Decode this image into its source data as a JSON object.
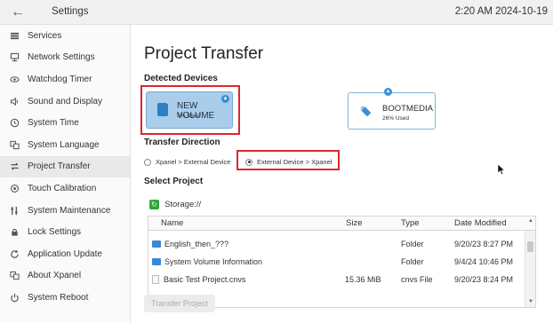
{
  "topbar": {
    "back_icon": "arrow-left-icon",
    "title": "Settings",
    "datetime": "2:20 AM 2024-10-19"
  },
  "sidebar": {
    "items": [
      {
        "label": "Services",
        "icon": "services-icon"
      },
      {
        "label": "Network Settings",
        "icon": "network-icon"
      },
      {
        "label": "Watchdog Timer",
        "icon": "eye-icon"
      },
      {
        "label": "Sound and Display",
        "icon": "speaker-icon"
      },
      {
        "label": "System Time",
        "icon": "clock-icon"
      },
      {
        "label": "System Language",
        "icon": "language-icon"
      },
      {
        "label": "Project Transfer",
        "icon": "transfer-icon",
        "active": true
      },
      {
        "label": "Touch Calibration",
        "icon": "target-icon"
      },
      {
        "label": "System Maintenance",
        "icon": "maintenance-icon"
      },
      {
        "label": "Lock Settings",
        "icon": "lock-icon"
      },
      {
        "label": "Application Update",
        "icon": "refresh-icon"
      },
      {
        "label": "About Xpanel",
        "icon": "info-icon"
      },
      {
        "label": "System Reboot",
        "icon": "power-icon"
      }
    ]
  },
  "main": {
    "title": "Project Transfer",
    "detected_devices_label": "Detected Devices",
    "devices": [
      {
        "name": "NEW VOLUME",
        "usage": "5% Used",
        "selected": true,
        "icon": "sd-card-icon"
      },
      {
        "name": "BOOTMEDIA",
        "usage": "26% Used",
        "selected": false,
        "icon": "usb-drive-icon"
      }
    ],
    "transfer_direction_label": "Transfer Direction",
    "directions": [
      {
        "label": "Xpanel > External Device",
        "selected": false
      },
      {
        "label": "External Device > Xpanel",
        "selected": true
      }
    ],
    "select_project_label": "Select Project",
    "storage_path": "Storage://",
    "table": {
      "columns": [
        "Name",
        "Size",
        "Type",
        "Date Modified"
      ],
      "rows": [
        {
          "name": "English_then_???",
          "size": "",
          "type": "Folder",
          "date": "9/20/23 8:27 PM",
          "kind": "folder"
        },
        {
          "name": "System Volume Information",
          "size": "",
          "type": "Folder",
          "date": "9/4/24 10:46 PM",
          "kind": "folder"
        },
        {
          "name": "Basic Test Project.cnvs",
          "size": "15.36 MiB",
          "type": "cnvs File",
          "date": "9/20/23 8:24 PM",
          "kind": "file"
        }
      ]
    },
    "transfer_button": "Transfer Project"
  },
  "colors": {
    "accent": "#3a8fd4",
    "selected_device": "#a9cdea",
    "highlight_box": "#d9272e",
    "refresh_green": "#2fa63e"
  }
}
